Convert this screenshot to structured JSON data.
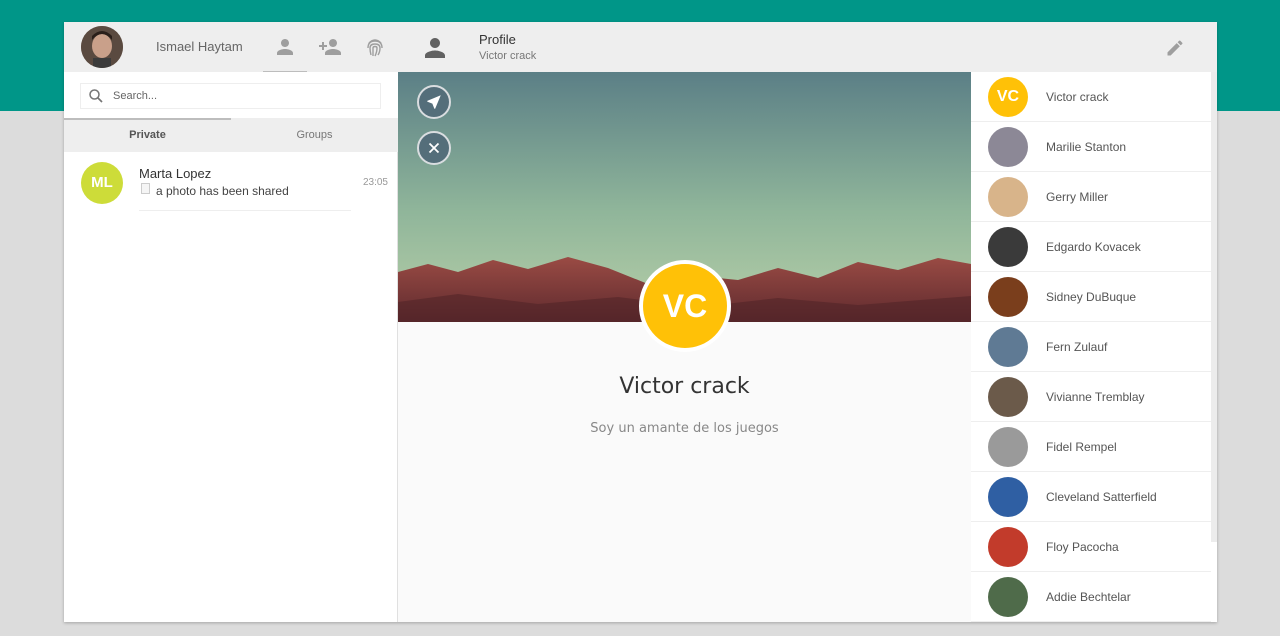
{
  "user": {
    "name": "Ismael Haytam"
  },
  "header_icons": [
    "person-icon",
    "person-add-icon",
    "fingerprint-icon"
  ],
  "search": {
    "placeholder": "Search..."
  },
  "tabs": [
    {
      "label": "Private"
    },
    {
      "label": "Groups"
    }
  ],
  "chats": [
    {
      "initials": "ML",
      "name": "Marta Lopez",
      "message": "a photo has been shared",
      "time": "23:05"
    }
  ],
  "profile": {
    "title": "Profile",
    "subtitle": "Victor crack",
    "initials": "VC",
    "name": "Victor crack",
    "bio": "Soy un amante de los juegos"
  },
  "contacts": [
    {
      "name": "Victor crack",
      "initials": "VC"
    },
    {
      "name": "Marilie Stanton",
      "color": "#8c8896"
    },
    {
      "name": "Gerry Miller",
      "color": "#d8b48a"
    },
    {
      "name": "Edgardo Kovacek",
      "color": "#3a3a3a"
    },
    {
      "name": "Sidney DuBuque",
      "color": "#7a3e1c"
    },
    {
      "name": "Fern Zulauf",
      "color": "#5f7a94"
    },
    {
      "name": "Vivianne Tremblay",
      "color": "#6b5a4a"
    },
    {
      "name": "Fidel Rempel",
      "color": "#9a9a9a"
    },
    {
      "name": "Cleveland Satterfield",
      "color": "#2f5fa3"
    },
    {
      "name": "Floy Pacocha",
      "color": "#c23b2b"
    },
    {
      "name": "Addie Bechtelar",
      "color": "#4f6b4a"
    }
  ],
  "colors": {
    "teal": "#009688",
    "amber": "#ffc107",
    "lime": "#cddc39",
    "slate": "#546e7a"
  }
}
